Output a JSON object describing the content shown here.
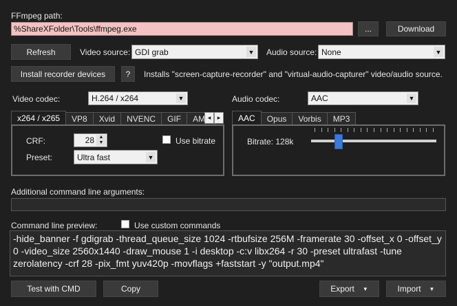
{
  "ffmpeg": {
    "path_label": "FFmpeg path:",
    "path_value": "%ShareXFolder\\Tools\\ffmpeg.exe",
    "browse_label": "...",
    "download_label": "Download"
  },
  "sources": {
    "refresh_label": "Refresh",
    "video_source_label": "Video source:",
    "video_source_value": "GDI grab",
    "audio_source_label": "Audio source:",
    "audio_source_value": "None"
  },
  "install": {
    "button_label": "Install recorder devices",
    "help_label": "?",
    "description": "Installs \"screen-capture-recorder\" and \"virtual-audio-capturer\" video/audio source."
  },
  "video_codec": {
    "label": "Video codec:",
    "value": "H.264 / x264",
    "tabs": [
      "x264 / x265",
      "VP8",
      "Xvid",
      "NVENC",
      "GIF",
      "AMF"
    ],
    "scroll_left": "◂",
    "scroll_right": "▸",
    "crf_label": "CRF:",
    "crf_value": "28",
    "use_bitrate_label": "Use bitrate",
    "preset_label": "Preset:",
    "preset_value": "Ultra fast"
  },
  "audio_codec": {
    "label": "Audio codec:",
    "value": "AAC",
    "tabs": [
      "AAC",
      "Opus",
      "Vorbis",
      "MP3"
    ],
    "bitrate_label": "Bitrate: 128k",
    "slider_fraction": 0.2
  },
  "additional_args": {
    "label": "Additional command line arguments:",
    "value": ""
  },
  "preview": {
    "label": "Command line preview:",
    "use_custom_label": "Use custom commands",
    "text": "-hide_banner -f gdigrab -thread_queue_size 1024 -rtbufsize 256M -framerate 30 -offset_x 0 -offset_y 0 -video_size 2560x1440 -draw_mouse 1 -i desktop -c:v libx264 -r 30 -preset ultrafast -tune zerolatency -crf 28 -pix_fmt yuv420p -movflags +faststart -y \"output.mp4\""
  },
  "footer": {
    "test_label": "Test with CMD",
    "copy_label": "Copy",
    "export_label": "Export",
    "import_label": "Import"
  },
  "colors": {
    "path_background": "#f4c2c2",
    "slider_thumb": "#3c78d8"
  }
}
